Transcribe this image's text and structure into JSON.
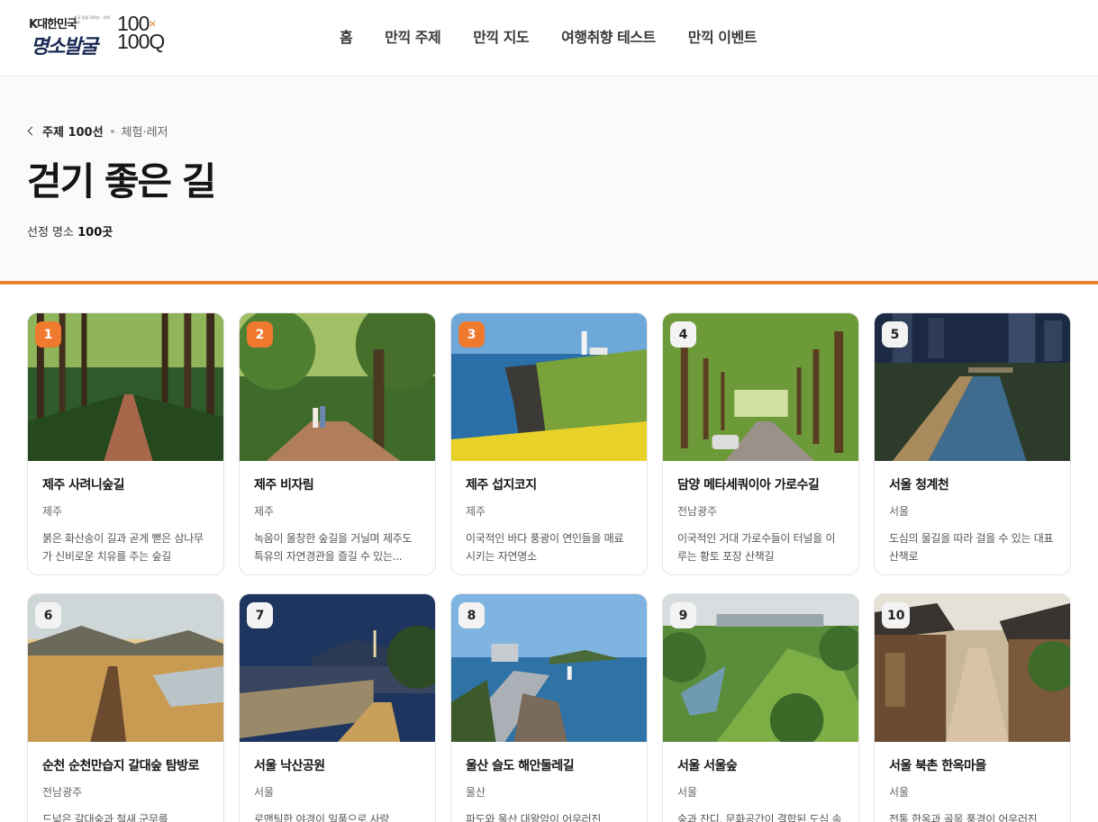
{
  "header": {
    "logo": {
      "top_text": "K대한민국",
      "sub_text": "한국 관광 100선 · 지역 명소",
      "main_text": "명소발굴",
      "hundred": "100",
      "q": "100Q",
      "x": "×"
    },
    "nav": [
      "홈",
      "만끽 주제",
      "만끽 지도",
      "여행취향 테스트",
      "만끽 이벤트"
    ]
  },
  "hero": {
    "breadcrumb_back": "주제 100선",
    "breadcrumb_category": "체험·레저",
    "title": "걷기 좋은 길",
    "count_label": "선정 명소",
    "count_value": "100곳"
  },
  "colors": {
    "accent": "#e7822c",
    "rank_top": "#ef7a2e",
    "rank_normal": "#f3f3f3"
  },
  "cards": [
    {
      "rank": "1",
      "title": "제주 사려니숲길",
      "region": "제주",
      "desc": "붉은 화산송이 길과 곧게 뻗은 삼나무가 신비로운 치유를 주는 숲길",
      "scene": "cedar-forest"
    },
    {
      "rank": "2",
      "title": "제주 비자림",
      "region": "제주",
      "desc": "녹음이 울창한 숲길을 거닐며 제주도 특유의 자연경관을 즐길 수 있는...",
      "scene": "forest-couple"
    },
    {
      "rank": "3",
      "title": "제주 섭지코지",
      "region": "제주",
      "desc": "이국적인 바다 풍광이 연인들을 매료시키는 자연명소",
      "scene": "coastal-lighthouse"
    },
    {
      "rank": "4",
      "title": "담양 메타세쿼이아 가로수길",
      "region": "전남광주",
      "desc": "이국적인 거대 가로수들이 터널을 이루는 황토 포장 산책길",
      "scene": "tree-tunnel"
    },
    {
      "rank": "5",
      "title": "서울 청계천",
      "region": "서울",
      "desc": "도심의 물길을 따라 걸을 수 있는 대표 산책로",
      "scene": "city-stream-night"
    },
    {
      "rank": "6",
      "title": "순천 순천만습지 갈대숲 탐방로",
      "region": "전남광주",
      "desc": "드넓은 갈대숲과 철새 군무를",
      "scene": "reed-wetland"
    },
    {
      "rank": "7",
      "title": "서울 낙산공원",
      "region": "서울",
      "desc": "로맨틱한 야경이 일품으로 사랑",
      "scene": "fortress-night"
    },
    {
      "rank": "8",
      "title": "울산 슬도 해안둘레길",
      "region": "울산",
      "desc": "파도와 울산 대왕암이 어우러진",
      "scene": "coastal-walk"
    },
    {
      "rank": "9",
      "title": "서울 서울숲",
      "region": "서울",
      "desc": "숲과 잔디, 문화공간이 결합된 도심 속",
      "scene": "urban-park"
    },
    {
      "rank": "10",
      "title": "서울 북촌 한옥마을",
      "region": "서울",
      "desc": "전통 한옥과 골목 풍경이 어우러진",
      "scene": "hanok-alley"
    }
  ]
}
